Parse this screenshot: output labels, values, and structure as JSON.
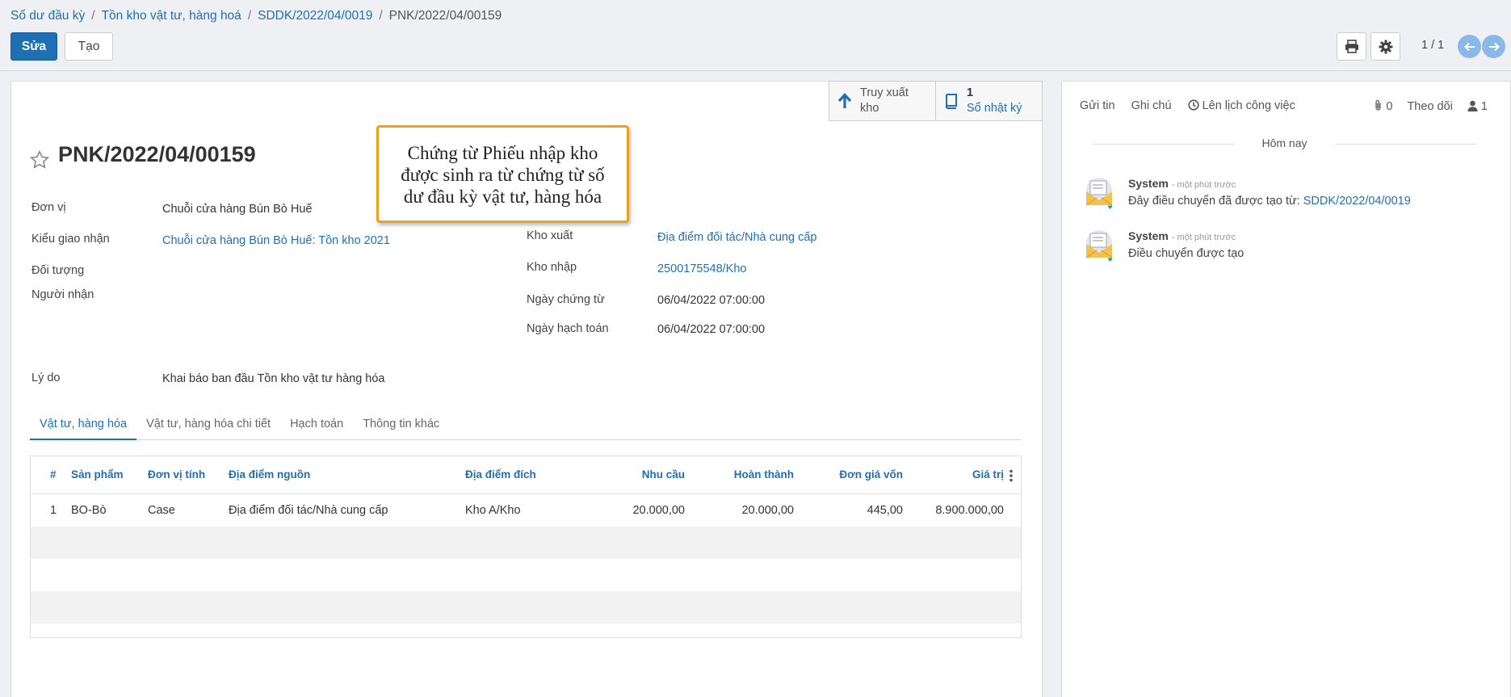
{
  "breadcrumb": {
    "items": [
      "Số dư đầu kỳ",
      "Tồn kho vật tư, hàng hoá",
      "SDDK/2022/04/0019"
    ],
    "current": "PNK/2022/04/00159",
    "sep": "/"
  },
  "toolbar": {
    "edit_label": "Sửa",
    "create_label": "Tạo",
    "pager": "1 / 1"
  },
  "smart_buttons": {
    "trace": {
      "line1": "Truy xuất",
      "line2": "kho"
    },
    "journal": {
      "count": "1",
      "label": "Sổ nhật ký"
    }
  },
  "record": {
    "title": "PNK/2022/04/00159",
    "left_fields": [
      {
        "label": "Đơn vị",
        "value": "Chuỗi cửa hàng Bún Bò Huế"
      },
      {
        "label": "Kiểu giao nhận",
        "value": "Chuỗi cửa hàng Bún Bò Huế: Tồn kho 2021"
      },
      {
        "label": "Đối tượng",
        "value": ""
      },
      {
        "label": "Người nhận",
        "value": ""
      }
    ],
    "right_fields": [
      {
        "label": "Kho xuất",
        "value": "Địa điểm đối tác/Nhà cung cấp"
      },
      {
        "label": "Kho nhập",
        "value": "2500175548/Kho"
      },
      {
        "label": "Ngày chứng từ",
        "value": "06/04/2022 07:00:00"
      },
      {
        "label": "Ngày hạch toán",
        "value": "06/04/2022 07:00:00"
      }
    ],
    "reason": {
      "label": "Lý do",
      "value": "Khai báo ban đầu Tồn kho vật tư hàng hóa"
    }
  },
  "annotation": {
    "lines": [
      "Chứng từ Phiếu nhập kho",
      "được sinh ra từ chứng từ số",
      "dư đầu kỳ vật tư, hàng hóa"
    ]
  },
  "tabs": [
    "Vật tư, hàng hóa",
    "Vật tư, hàng hóa chi tiết",
    "Hạch toán",
    "Thông tin khác"
  ],
  "table": {
    "headers": [
      "#",
      "Sản phẩm",
      "Đơn vị tính",
      "Địa điểm nguồn",
      "Địa điểm đích",
      "Nhu cầu",
      "Hoàn thành",
      "Đơn giá vốn",
      "Giá trị"
    ],
    "rows": [
      [
        "1",
        "BO-Bò",
        "Case",
        "Địa điểm đối tác/Nhà cung cấp",
        "Kho A/Kho",
        "20.000,00",
        "20.000,00",
        "445,00",
        "8.900.000,00"
      ]
    ]
  },
  "chatter": {
    "actions": [
      "Gửi tin",
      "Ghi chú",
      "Lên lịch công việc"
    ],
    "attachments": "0",
    "follow": "Theo dõi",
    "followers": "1",
    "day": "Hôm nay",
    "messages": [
      {
        "author": "System",
        "time": "- một phút trước",
        "text": "Đây điều chuyển đã được tạo từ: ",
        "link": "SDDK/2022/04/0019"
      },
      {
        "author": "System",
        "time": "- một phút trước",
        "text": "Điều chuyển được tạo",
        "link": ""
      }
    ]
  },
  "colors": {
    "primary": "#1f6fb5",
    "highlight": "#f0a11b",
    "nav": "#8ab8e8"
  }
}
